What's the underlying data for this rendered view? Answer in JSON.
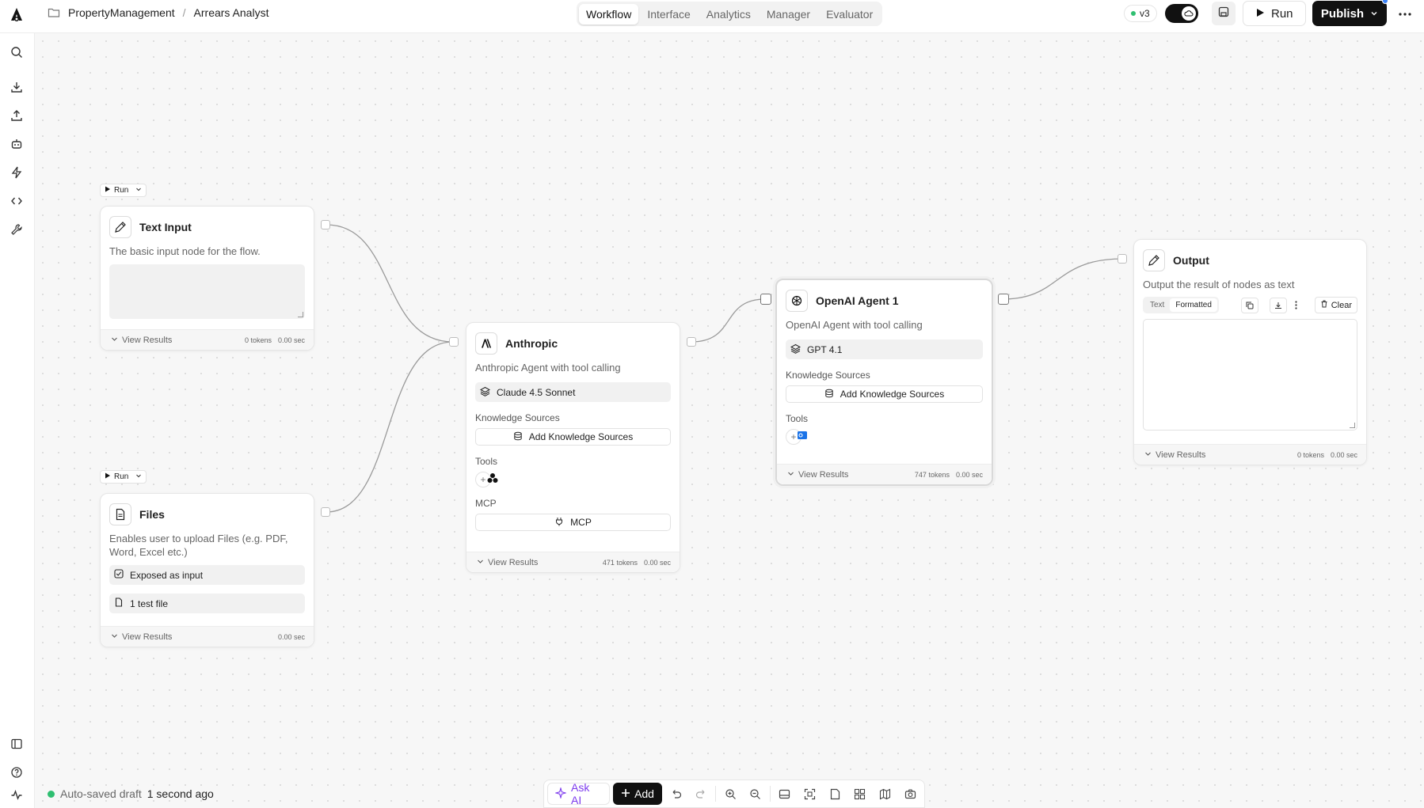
{
  "header": {
    "breadcrumb": [
      "PropertyManagement",
      "Arrears Analyst"
    ],
    "tabs": [
      {
        "label": "Workflow",
        "active": true
      },
      {
        "label": "Interface",
        "active": false
      },
      {
        "label": "Analytics",
        "active": false
      },
      {
        "label": "Manager",
        "active": false
      },
      {
        "label": "Evaluator",
        "active": false
      }
    ],
    "version": "v3",
    "run_label": "Run",
    "publish_label": "Publish"
  },
  "sidebar": {
    "icons": [
      "search-icon",
      "download-icon",
      "upload-icon",
      "bot-icon",
      "lightning-icon",
      "code-icon",
      "wrench-icon"
    ],
    "bottom_icons": [
      "panel-icon",
      "help-icon",
      "activity-icon"
    ]
  },
  "nodes": {
    "text_input": {
      "run_label": "Run",
      "title": "Text Input",
      "description": "The basic input node for the flow.",
      "view_results": "View Results",
      "tokens": "0 tokens",
      "time": "0.00 sec"
    },
    "files": {
      "run_label": "Run",
      "title": "Files",
      "description": "Enables user to upload Files (e.g. PDF, Word, Excel etc.)",
      "exposed_label": "Exposed as input",
      "file_label": "1 test file",
      "view_results": "View Results",
      "time": "0.00 sec"
    },
    "anthropic": {
      "title": "Anthropic",
      "description": "Anthropic Agent with tool calling",
      "model": "Claude 4.5 Sonnet",
      "knowledge_label": "Knowledge Sources",
      "add_knowledge": "Add Knowledge Sources",
      "tools_label": "Tools",
      "mcp_label": "MCP",
      "mcp_button": "MCP",
      "view_results": "View Results",
      "tokens": "471 tokens",
      "time": "0.00 sec"
    },
    "openai": {
      "title": "OpenAI Agent 1",
      "description": "OpenAI Agent with tool calling",
      "model": "GPT 4.1",
      "knowledge_label": "Knowledge Sources",
      "add_knowledge": "Add Knowledge Sources",
      "tools_label": "Tools",
      "view_results": "View Results",
      "tokens": "747 tokens",
      "time": "0.00 sec"
    },
    "output": {
      "title": "Output",
      "description": "Output the result of nodes as text",
      "tab_text": "Text",
      "tab_formatted": "Formatted",
      "clear_label": "Clear",
      "view_results": "View Results",
      "tokens": "0 tokens",
      "time": "0.00 sec"
    }
  },
  "status": {
    "autosave_prefix": "Auto-saved draft",
    "autosave_time": "1 second ago"
  },
  "toolbar": {
    "ask_ai": "Ask AI",
    "add": "Add"
  },
  "colors": {
    "accent_dark": "#111111",
    "status_green": "#2fbf71",
    "ask_ai_purple": "#7c3aed",
    "notification_blue": "#3b82f6"
  }
}
